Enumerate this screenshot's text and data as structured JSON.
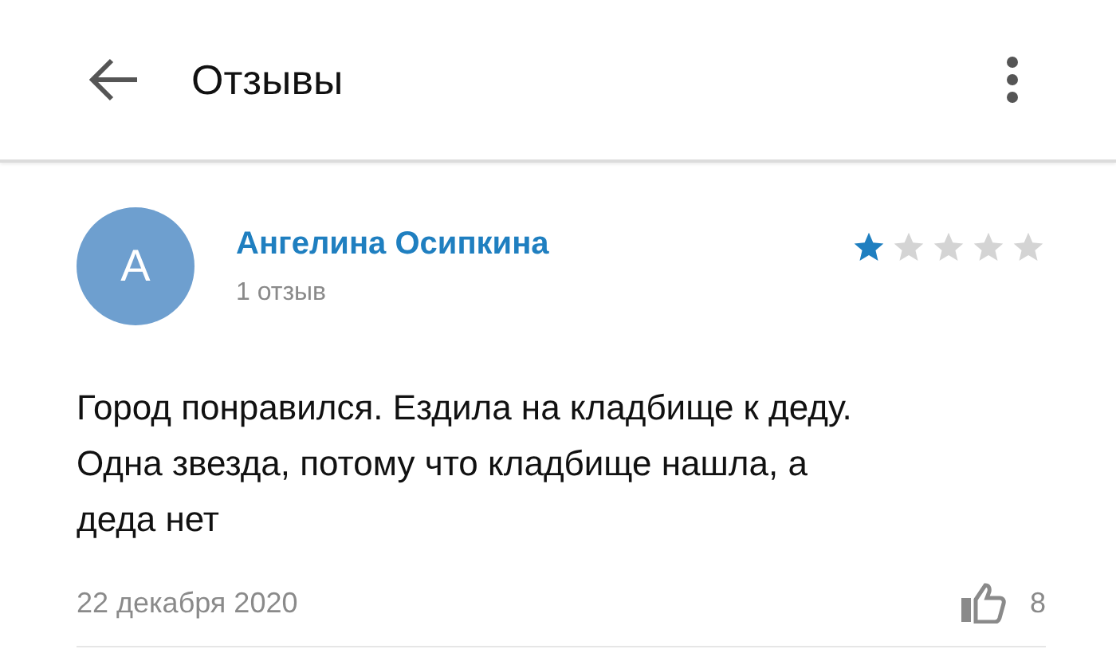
{
  "header": {
    "title": "Отзывы"
  },
  "review": {
    "avatar_letter": "А",
    "author": "Ангелина Осипкина",
    "author_reviews": "1 отзыв",
    "stars": 1,
    "text": "Город понравился. Ездила на кладбище к деду. Одна звезда, потому что кладбище нашла, а деда нет",
    "date": "22 декабря 2020",
    "likes": "8"
  }
}
